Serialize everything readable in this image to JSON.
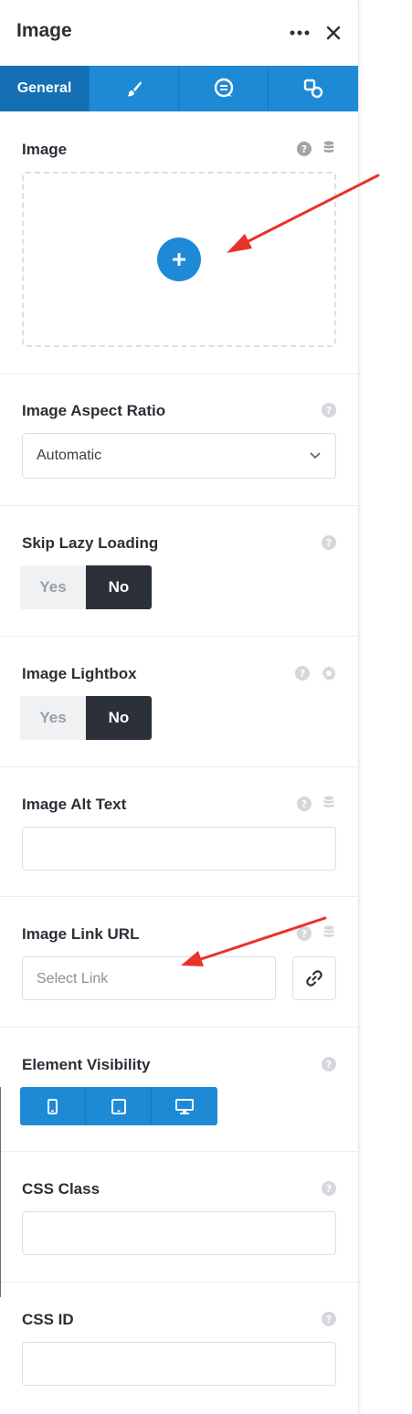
{
  "header": {
    "title": "Image",
    "more_icon": "ellipsis-icon",
    "close_icon": "close-icon"
  },
  "tabs": [
    {
      "label": "General",
      "active": true
    },
    {
      "label": "",
      "icon": "brush-icon"
    },
    {
      "label": "",
      "icon": "chat-bubble-icon"
    },
    {
      "label": "",
      "icon": "shapes-icon"
    }
  ],
  "sections": {
    "image": {
      "label": "Image"
    },
    "aspect_ratio": {
      "label": "Image Aspect Ratio",
      "value": "Automatic"
    },
    "lazy_loading": {
      "label": "Skip Lazy Loading",
      "yes": "Yes",
      "no": "No",
      "selected": "No"
    },
    "lightbox": {
      "label": "Image Lightbox",
      "yes": "Yes",
      "no": "No",
      "selected": "No"
    },
    "alt_text": {
      "label": "Image Alt Text",
      "value": ""
    },
    "link_url": {
      "label": "Image Link URL",
      "placeholder": "Select Link"
    },
    "visibility": {
      "label": "Element Visibility",
      "devices": [
        "mobile-icon",
        "tablet-icon",
        "desktop-icon"
      ]
    },
    "css_class": {
      "label": "CSS Class",
      "value": ""
    },
    "css_id": {
      "label": "CSS ID",
      "value": ""
    }
  },
  "colors": {
    "accent": "#1e8ad6",
    "toggle_on": "#2c3038",
    "annotation_arrow": "#e8322b"
  }
}
